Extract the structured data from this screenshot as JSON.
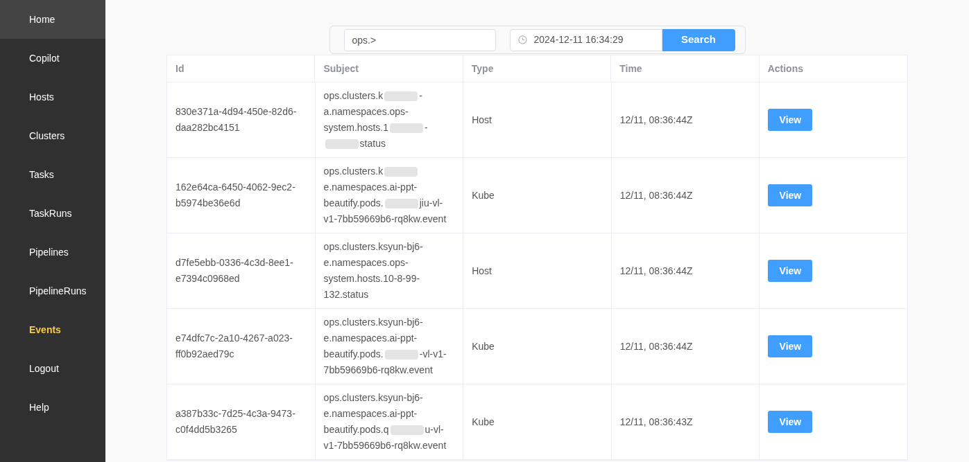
{
  "sidebar": {
    "items": [
      {
        "label": "Home",
        "selected": false,
        "highlighted": true
      },
      {
        "label": "Copilot",
        "selected": false,
        "highlighted": false
      },
      {
        "label": "Hosts",
        "selected": false,
        "highlighted": false
      },
      {
        "label": "Clusters",
        "selected": false,
        "highlighted": false
      },
      {
        "label": "Tasks",
        "selected": false,
        "highlighted": false
      },
      {
        "label": "TaskRuns",
        "selected": false,
        "highlighted": false
      },
      {
        "label": "Pipelines",
        "selected": false,
        "highlighted": false
      },
      {
        "label": "PipelineRuns",
        "selected": false,
        "highlighted": false
      },
      {
        "label": "Events",
        "selected": true,
        "highlighted": false
      },
      {
        "label": "Logout",
        "selected": false,
        "highlighted": false
      },
      {
        "label": "Help",
        "selected": false,
        "highlighted": false
      }
    ]
  },
  "search": {
    "subject": "ops.>",
    "time": "2024-12-11 16:34:29",
    "button": "Search"
  },
  "table": {
    "columns": [
      "Id",
      "Subject",
      "Type",
      "Time",
      "Actions"
    ],
    "rows": [
      {
        "id": "830e371a-4d94-450e-82d6-daa282bc4151",
        "subject": [
          "ops.clusters.k",
          "-a.namespaces.ops-system.hosts.1",
          "-",
          "status"
        ],
        "type": "Host",
        "time": "12/11, 08:36:44Z",
        "action": "View"
      },
      {
        "id": "162e64ca-6450-4062-9ec2-b5974be36e6d",
        "subject": [
          "ops.clusters.k",
          "e.namespaces.ai-ppt-beautify.pods.",
          "jiu-vl-v1-7bb59669b6-rq8kw.event"
        ],
        "type": "Kube",
        "time": "12/11, 08:36:44Z",
        "action": "View"
      },
      {
        "id": "d7fe5ebb-0336-4c3d-8ee1-e7394c0968ed",
        "subject": [
          "ops.clusters.ksyun-bj6-e.namespaces.ops-system.hosts.10-8-99-132.status"
        ],
        "type": "Host",
        "time": "12/11, 08:36:44Z",
        "action": "View"
      },
      {
        "id": "e74dfc7c-2a10-4267-a023-ff0b92aed79c",
        "subject": [
          "ops.clusters.ksyun-bj6-e.namespaces.ai-ppt-beautify.pods.",
          "-vl-v1-7bb59669b6-rq8kw.event"
        ],
        "type": "Kube",
        "time": "12/11, 08:36:44Z",
        "action": "View"
      },
      {
        "id": "a387b33c-7d25-4c3a-9473-c0f4dd5b3265",
        "subject": [
          "ops.clusters.ksyun-bj6-e.namespaces.ai-ppt-beautify.pods.q",
          "u-vl-v1-7bb59669b6-rq8kw.event"
        ],
        "type": "Kube",
        "time": "12/11, 08:36:43Z",
        "action": "View"
      }
    ]
  }
}
